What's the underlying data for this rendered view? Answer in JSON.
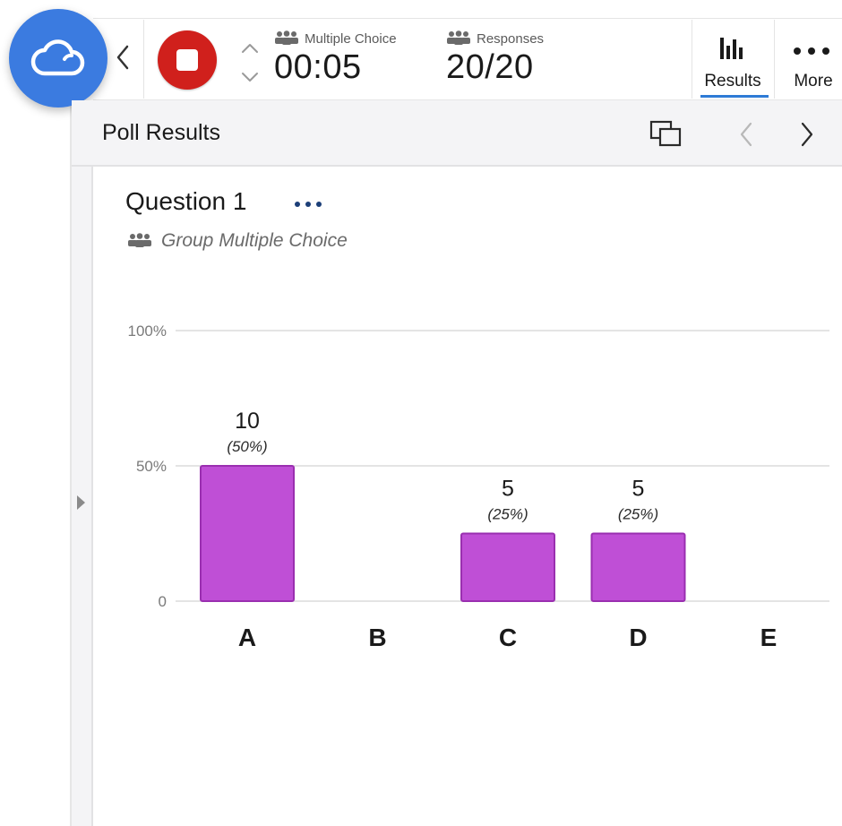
{
  "toolbar": {
    "question_type_caption": "Multiple Choice",
    "timer": "00:05",
    "responses_caption": "Responses",
    "responses_value": "20/20",
    "results_label": "Results",
    "more_label": "More"
  },
  "poll": {
    "title": "Poll Results"
  },
  "question": {
    "title": "Question 1",
    "type": "Group Multiple Choice"
  },
  "colors": {
    "bar": "#bf4fd6",
    "bar_border": "#9a2fb0",
    "stop": "#d0201c",
    "cloud": "#3b7be0",
    "accent": "#2e7bd6"
  },
  "chart_data": {
    "type": "bar",
    "categories": [
      "A",
      "B",
      "C",
      "D",
      "E"
    ],
    "values": [
      10,
      0,
      5,
      5,
      0
    ],
    "value_labels": [
      "10",
      "",
      "5",
      "5",
      ""
    ],
    "percent_labels": [
      "(50%)",
      "",
      "(25%)",
      "(25%)",
      ""
    ],
    "yticks": [
      "0",
      "50%",
      "100%"
    ],
    "ylim": [
      0,
      20
    ],
    "grid": true
  }
}
